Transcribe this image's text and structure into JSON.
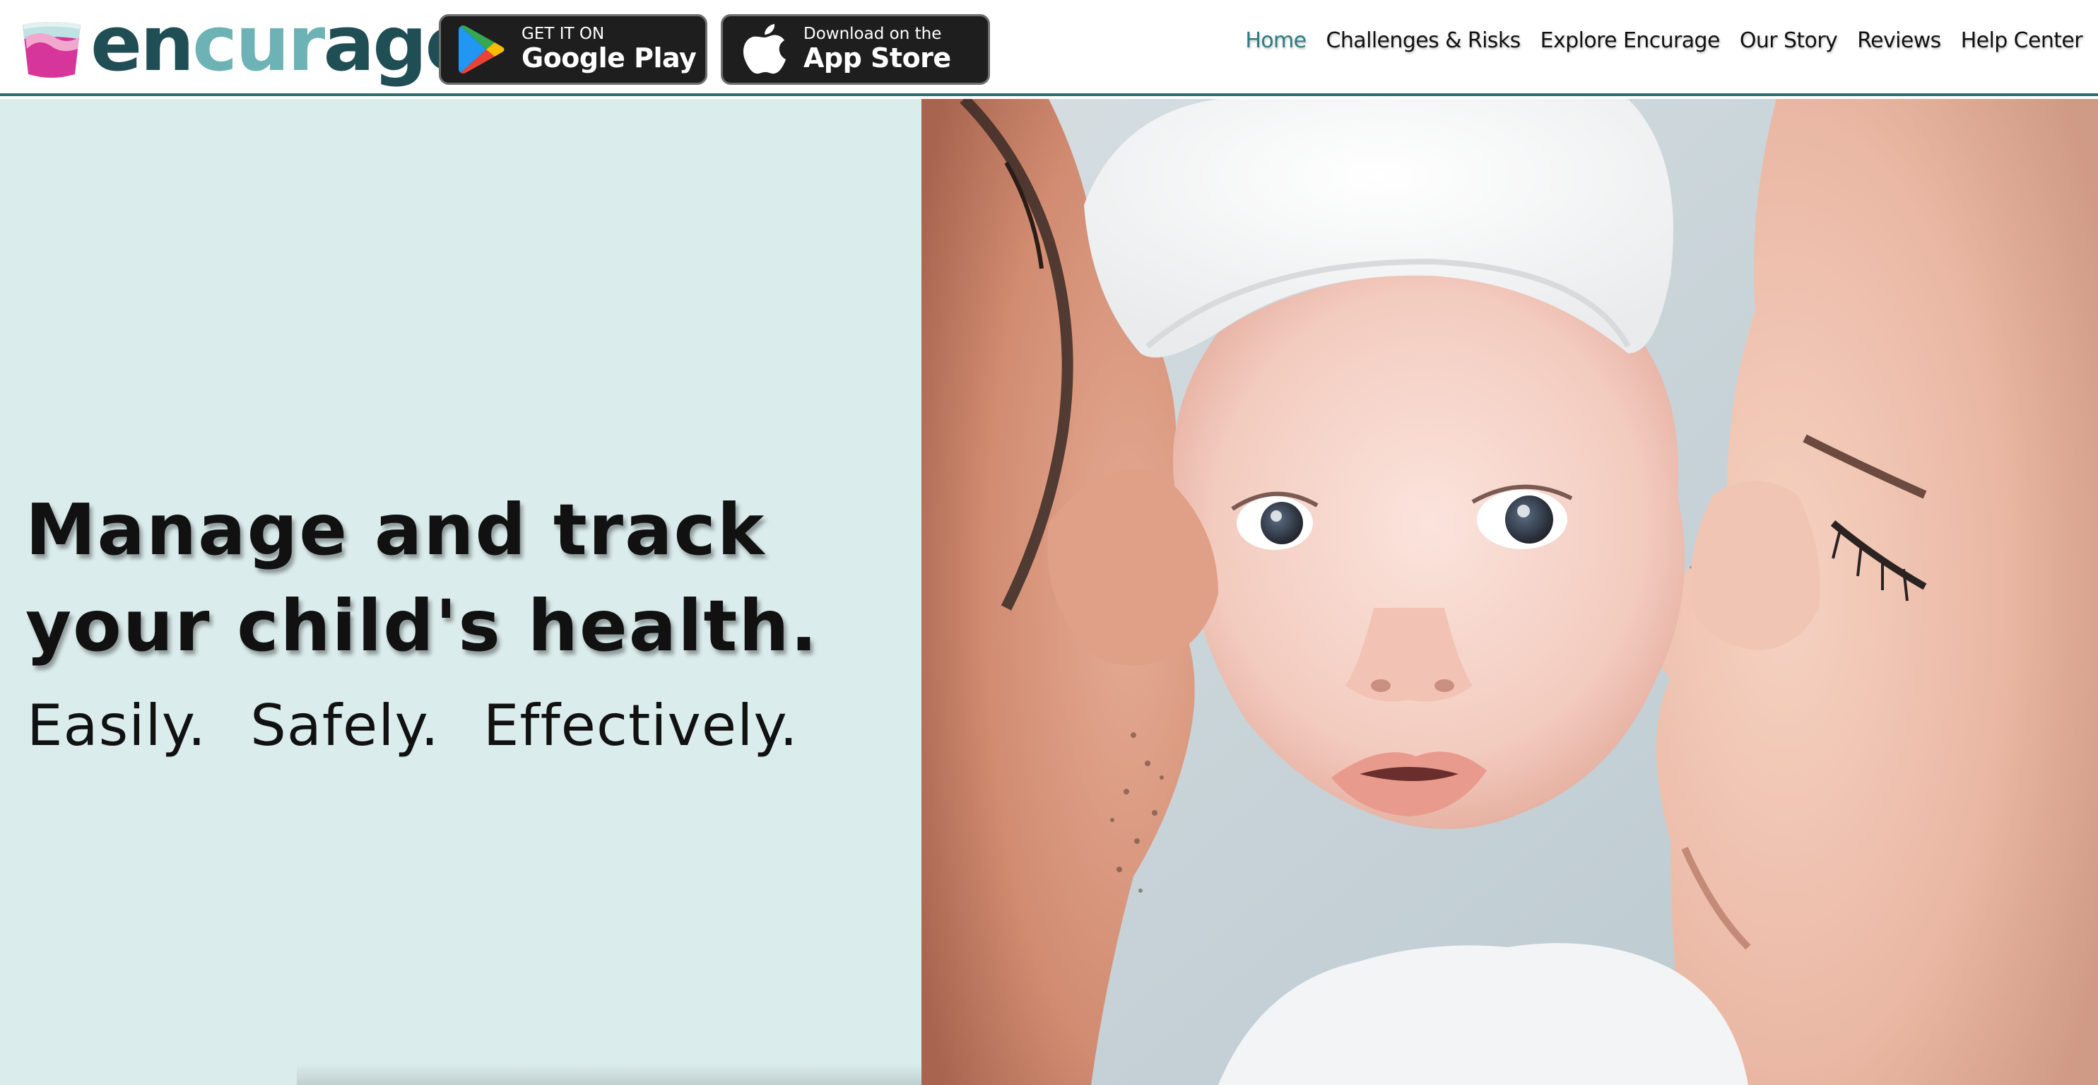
{
  "brand": {
    "name_part1": "en",
    "name_part2": "cur",
    "name_part3": "age",
    "colors": {
      "dark": "#1f4e55",
      "light": "#6db3b5",
      "cup": "#d6369a"
    }
  },
  "store_buttons": {
    "google_play": {
      "small": "GET IT ON",
      "big": "Google Play",
      "icon": "google-play-icon"
    },
    "app_store": {
      "small": "Download on the",
      "big": "App Store",
      "icon": "apple-icon"
    }
  },
  "nav": {
    "items": [
      {
        "label": "Home",
        "active": true
      },
      {
        "label": "Challenges & Risks",
        "active": false
      },
      {
        "label": "Explore Encurage",
        "active": false
      },
      {
        "label": "Our Story",
        "active": false
      },
      {
        "label": "Reviews",
        "active": false
      },
      {
        "label": "Help Center",
        "active": false
      }
    ]
  },
  "hero": {
    "headline_line1": "Manage and track",
    "headline_line2": "your child's health.",
    "taglines": [
      "Easily.",
      "Safely.",
      "Effectively."
    ],
    "background": "#dbecec",
    "photo_alt": "hero-family-photo"
  },
  "colors": {
    "accent": "#2d7c80",
    "header_border": "#2d6e73"
  }
}
